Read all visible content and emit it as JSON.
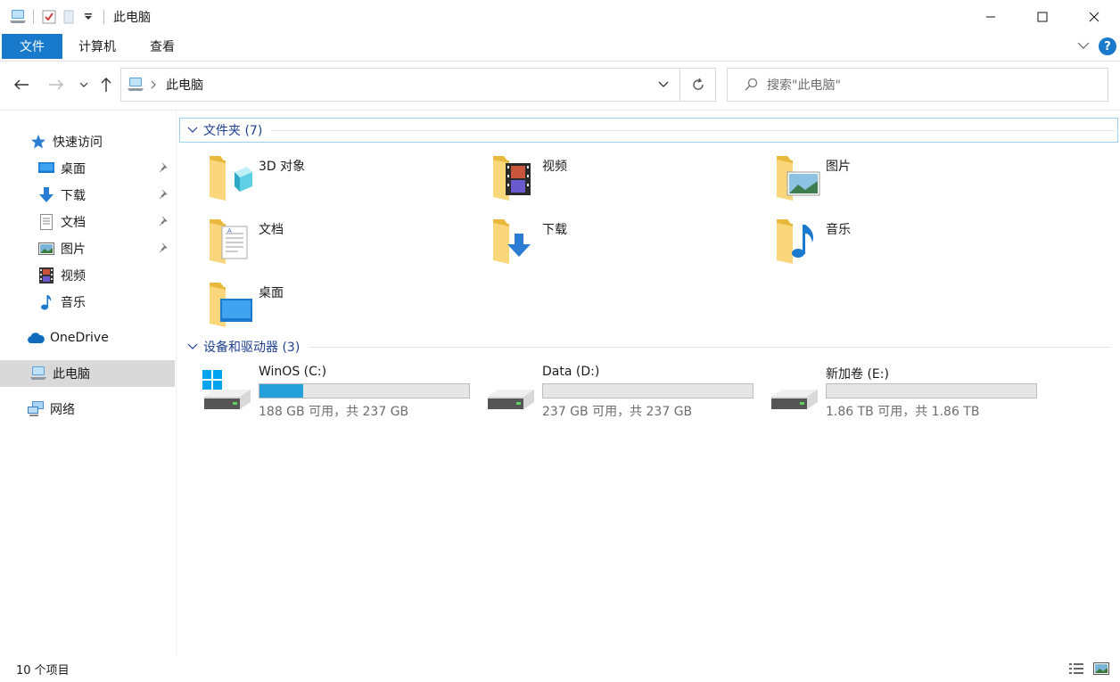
{
  "window": {
    "title": "此电脑",
    "controls": [
      "minimize-icon",
      "maximize-icon",
      "close-icon"
    ]
  },
  "ribbon": {
    "tabs": [
      {
        "label": "文件",
        "active": true
      },
      {
        "label": "计算机"
      },
      {
        "label": "查看"
      }
    ],
    "accent": "#1979ca",
    "help_label": "?"
  },
  "navbar": {
    "breadcrumb": "此电脑",
    "search_placeholder": "搜索\"此电脑\""
  },
  "sidebar": {
    "items": [
      {
        "label": "快速访问",
        "icon": "star-icon"
      },
      {
        "label": "桌面",
        "icon": "desktop-icon",
        "pinned": true
      },
      {
        "label": "下载",
        "icon": "download-icon",
        "pinned": true
      },
      {
        "label": "文档",
        "icon": "document-icon",
        "pinned": true
      },
      {
        "label": "图片",
        "icon": "picture-icon",
        "pinned": true
      },
      {
        "label": "视频",
        "icon": "video-icon"
      },
      {
        "label": "音乐",
        "icon": "music-icon"
      },
      {
        "label": "OneDrive",
        "icon": "cloud-icon"
      },
      {
        "label": "此电脑",
        "icon": "computer-icon",
        "selected": true
      },
      {
        "label": "网络",
        "icon": "network-icon"
      }
    ]
  },
  "folders_group": {
    "header": "文件夹 (7)",
    "items": [
      {
        "name": "3D 对象",
        "icon": "3d-objects-folder-icon"
      },
      {
        "name": "视频",
        "icon": "videos-folder-icon"
      },
      {
        "name": "图片",
        "icon": "pictures-folder-icon"
      },
      {
        "name": "文档",
        "icon": "documents-folder-icon"
      },
      {
        "name": "下载",
        "icon": "downloads-folder-icon"
      },
      {
        "name": "音乐",
        "icon": "music-folder-icon"
      },
      {
        "name": "桌面",
        "icon": "desktop-folder-icon"
      }
    ]
  },
  "drives_group": {
    "header": "设备和驱动器 (3)",
    "items": [
      {
        "name": "WinOS (C:)",
        "free_text": "188 GB 可用，共 237 GB",
        "used_fraction": 0.21,
        "system": true
      },
      {
        "name": "Data (D:)",
        "free_text": "237 GB 可用，共 237 GB",
        "used_fraction": 0.0
      },
      {
        "name": "新加卷 (E:)",
        "free_text": "1.86 TB 可用，共 1.86 TB",
        "used_fraction": 0.0
      }
    ],
    "bar_color": "#26a0da"
  },
  "status": {
    "item_count": "10 个项目"
  }
}
